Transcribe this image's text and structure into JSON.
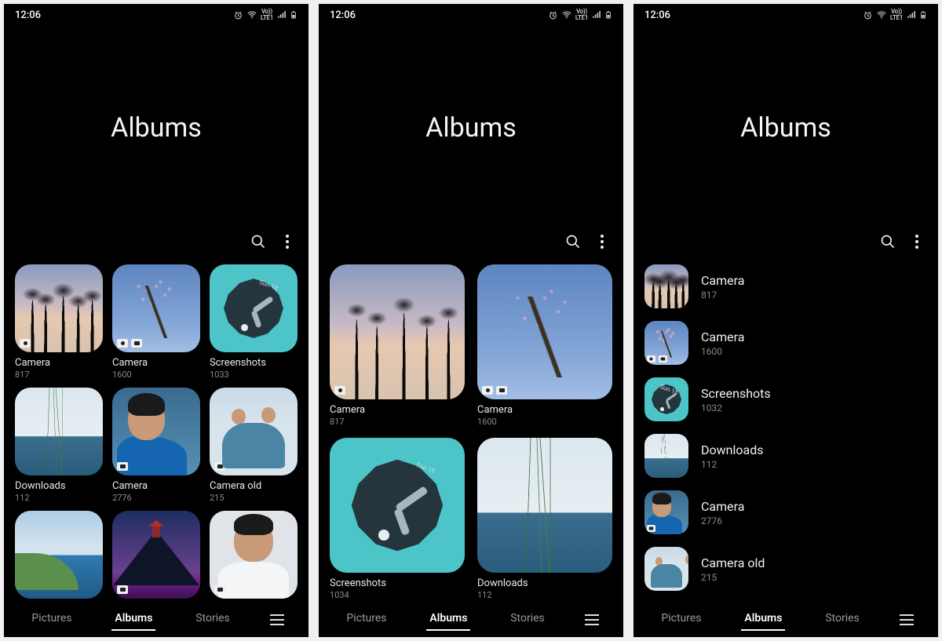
{
  "status": {
    "time": "12:06",
    "lte_label": "Vo))\nLTE1"
  },
  "header": {
    "title": "Albums"
  },
  "nav": {
    "pictures": "Pictures",
    "albums": "Albums",
    "stories": "Stories"
  },
  "phone1": {
    "albums": [
      {
        "name": "Camera",
        "count": "817",
        "art": "art-palms",
        "badges": [
          "camera"
        ]
      },
      {
        "name": "Camera",
        "count": "1600",
        "art": "art-blossom",
        "badges": [
          "camera",
          "sd"
        ]
      },
      {
        "name": "Screenshots",
        "count": "1033",
        "art": "art-clock",
        "badges": []
      },
      {
        "name": "Downloads",
        "count": "112",
        "art": "art-grass",
        "badges": []
      },
      {
        "name": "Camera",
        "count": "2776",
        "art": "art-portrait",
        "badges": [
          "sd"
        ]
      },
      {
        "name": "Camera old",
        "count": "215",
        "art": "art-group",
        "badges": [
          "sd"
        ]
      },
      {
        "name": "",
        "count": "",
        "art": "art-landscape",
        "badges": []
      },
      {
        "name": "",
        "count": "",
        "art": "art-mountain",
        "badges": [
          "sd"
        ]
      },
      {
        "name": "",
        "count": "",
        "art": "art-portrait2",
        "badges": [
          "sd"
        ]
      }
    ]
  },
  "phone2": {
    "albums": [
      {
        "name": "Camera",
        "count": "817",
        "art": "art-palms",
        "badges": [
          "camera"
        ]
      },
      {
        "name": "Camera",
        "count": "1600",
        "art": "art-blossom",
        "badges": [
          "camera",
          "sd"
        ]
      },
      {
        "name": "Screenshots",
        "count": "1034",
        "art": "art-clock",
        "badges": []
      },
      {
        "name": "Downloads",
        "count": "112",
        "art": "art-grass",
        "badges": []
      }
    ]
  },
  "phone3": {
    "albums": [
      {
        "name": "Camera",
        "count": "817",
        "art": "art-palms",
        "badges": []
      },
      {
        "name": "Camera",
        "count": "1600",
        "art": "art-blossom",
        "badges": [
          "camera",
          "sd"
        ]
      },
      {
        "name": "Screenshots",
        "count": "1032",
        "art": "art-clock",
        "badges": []
      },
      {
        "name": "Downloads",
        "count": "112",
        "art": "art-grass",
        "badges": []
      },
      {
        "name": "Camera",
        "count": "2776",
        "art": "art-portrait",
        "badges": [
          "sd"
        ]
      },
      {
        "name": "Camera old",
        "count": "215",
        "art": "art-group",
        "badges": []
      }
    ]
  },
  "clock_label": "Sun 18"
}
